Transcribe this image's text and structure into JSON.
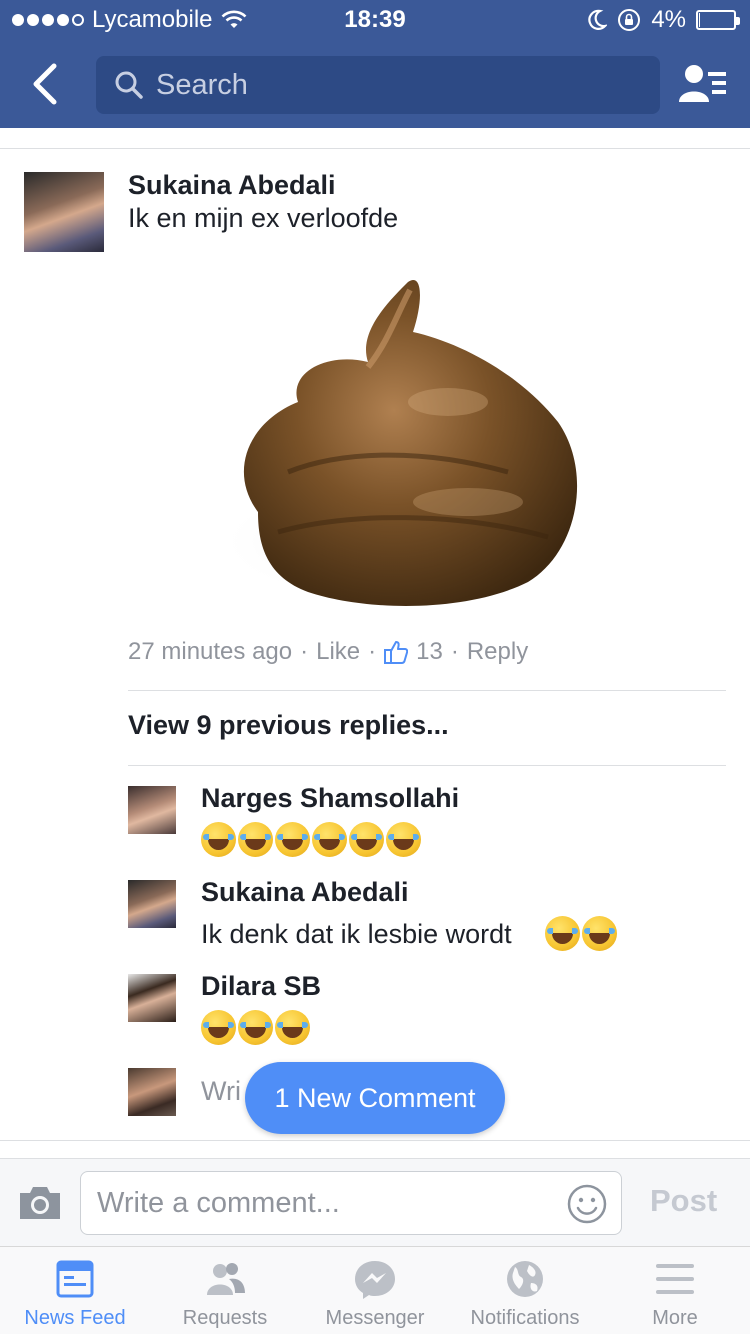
{
  "status_bar": {
    "carrier": "Lycamobile",
    "time": "18:39",
    "battery": "4%",
    "battery_level": 0.04
  },
  "header": {
    "search_placeholder": "Search"
  },
  "post": {
    "author": "Sukaina Abedali",
    "text": "Ik en mijn ex verloofde",
    "time": "27 minutes ago",
    "like_label": "Like",
    "like_count": "13",
    "reply_label": "Reply",
    "separator": "·"
  },
  "replies": {
    "view_previous": "View 9 previous replies...",
    "items": [
      {
        "author": "Narges Shamsollahi",
        "text": "",
        "emoji_count": 6
      },
      {
        "author": "Sukaina Abedali",
        "text": "Ik denk dat ik lesbie wordt",
        "emoji_count": 2
      },
      {
        "author": "Dilara SB",
        "text": "",
        "emoji_count": 3
      }
    ],
    "write_stub": "Wri"
  },
  "new_comment_pill": "1 New Comment",
  "composer": {
    "placeholder": "Write a comment...",
    "post_label": "Post"
  },
  "tabs": [
    {
      "label": "News Feed",
      "icon": "news-feed-icon",
      "active": true
    },
    {
      "label": "Requests",
      "icon": "requests-icon",
      "active": false
    },
    {
      "label": "Messenger",
      "icon": "messenger-icon",
      "active": false
    },
    {
      "label": "Notifications",
      "icon": "globe-icon",
      "active": false
    },
    {
      "label": "More",
      "icon": "menu-icon",
      "active": false
    }
  ],
  "colors": {
    "brand": "#3b5998",
    "accent": "#4f8ef7",
    "muted": "#90949c"
  }
}
